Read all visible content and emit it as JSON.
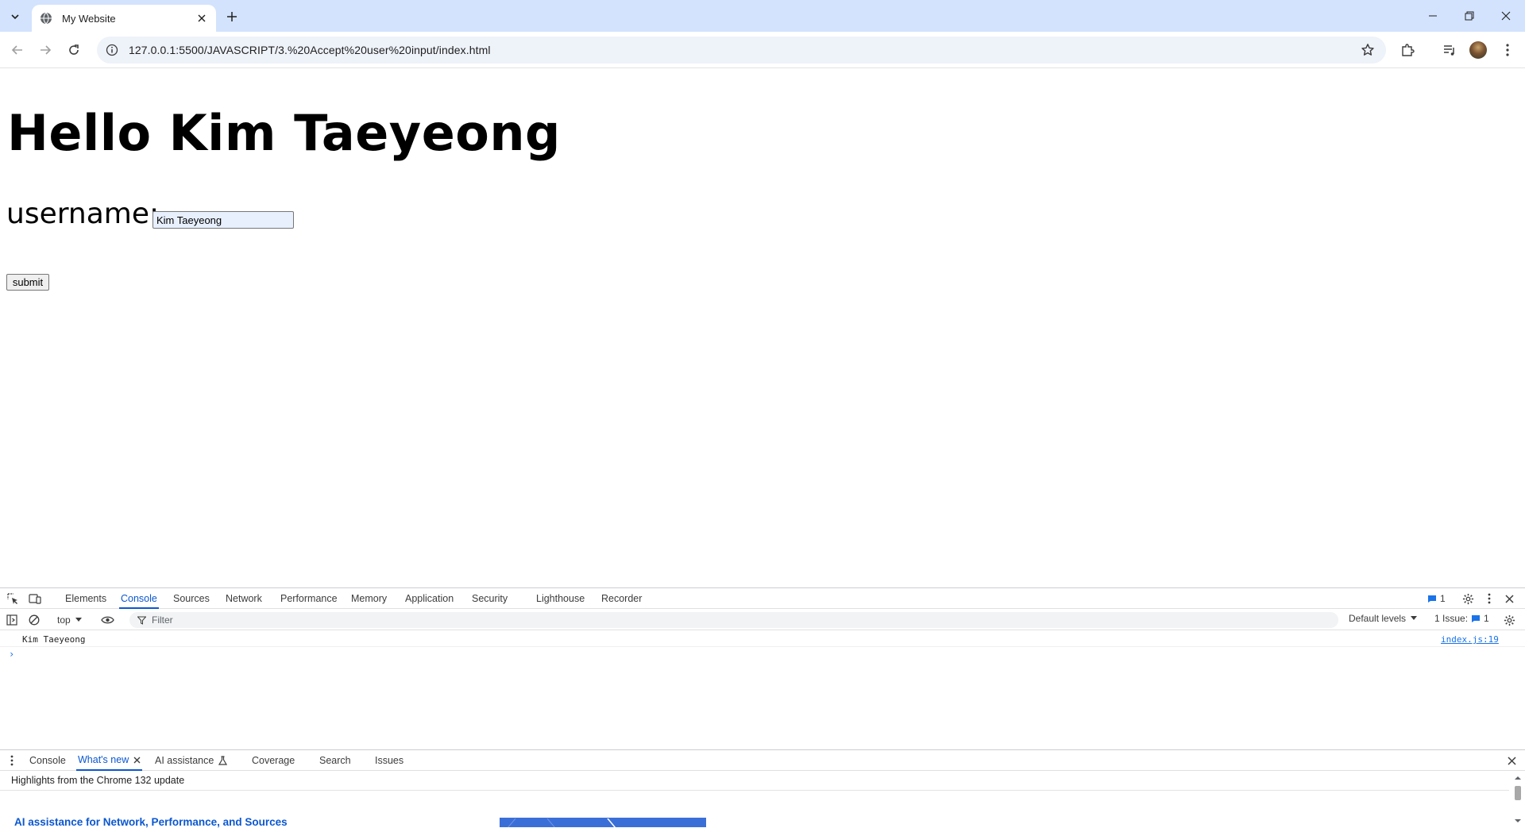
{
  "browser": {
    "tab_title": "My Website",
    "url": "127.0.0.1:5500/JAVASCRIPT/3.%20Accept%20user%20input/index.html"
  },
  "page": {
    "heading": "Hello Kim Taeyeong",
    "username_label": "username:",
    "username_value": "Kim Taeyeong",
    "submit_label": "submit"
  },
  "devtools": {
    "tabs": [
      "Elements",
      "Console",
      "Sources",
      "Network",
      "Performance",
      "Memory",
      "Application",
      "Security",
      "Lighthouse",
      "Recorder"
    ],
    "active_tab": "Console",
    "messages_badge": "1",
    "context": "top",
    "filter_placeholder": "Filter",
    "default_levels": "Default levels",
    "issues_label": "1 Issue:",
    "issues_count": "1",
    "log": {
      "message": "Kim Taeyeong",
      "source": "index.js:19"
    },
    "prompt_symbol": "›",
    "drawer_tabs": [
      "Console",
      "What's new",
      "AI assistance",
      "Coverage",
      "Search",
      "Issues"
    ],
    "drawer_active": "What's new",
    "whatsnew_heading": "Highlights from the Chrome 132 update",
    "whatsnew_link": "AI assistance for Network, Performance, and Sources"
  },
  "colors": {
    "tabstrip": "#d3e3fd",
    "accent": "#0b57d0",
    "link": "#1a73e8"
  }
}
